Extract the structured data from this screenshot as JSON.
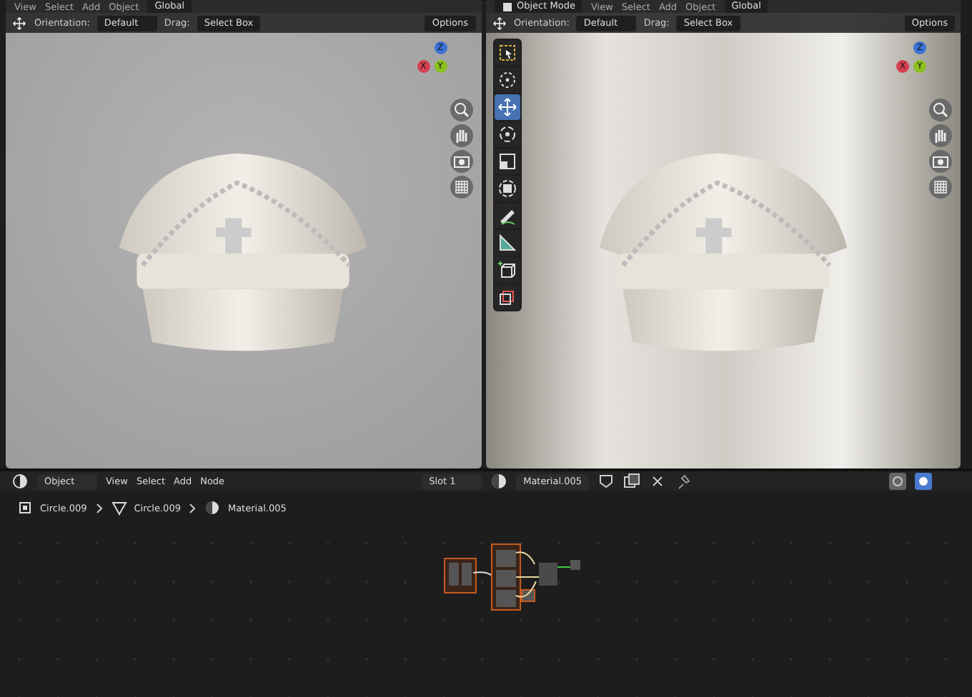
{
  "viewports": [
    {
      "menus": [
        "View",
        "Select",
        "Add",
        "Object"
      ],
      "transform": "Global",
      "orientation_label": "Orientation:",
      "orientation": "Default",
      "drag_label": "Drag:",
      "drag": "Select Box",
      "options": "Options",
      "gizmo": {
        "x": "X",
        "y": "Y",
        "z": "Z"
      }
    },
    {
      "mode": "Object Mode",
      "menus": [
        "View",
        "Select",
        "Add",
        "Object"
      ],
      "transform": "Global",
      "orientation_label": "Orientation:",
      "orientation": "Default",
      "drag_label": "Drag:",
      "drag": "Select Box",
      "options": "Options",
      "gizmo": {
        "x": "X",
        "y": "Y",
        "z": "Z"
      },
      "toolbar": [
        {
          "kind": "select",
          "selected": false
        },
        {
          "kind": "cursor",
          "selected": false
        },
        {
          "kind": "move",
          "selected": true
        },
        {
          "kind": "rotate",
          "selected": false
        },
        {
          "kind": "scale",
          "selected": false
        },
        {
          "kind": "transform",
          "selected": false
        },
        {
          "kind": "annotate",
          "selected": false
        },
        {
          "kind": "measure",
          "selected": false
        },
        {
          "kind": "add-cube",
          "selected": false
        },
        {
          "kind": "shear",
          "selected": false
        }
      ]
    }
  ],
  "node_editor": {
    "object_mode": "Object",
    "menus": [
      "View",
      "Select",
      "Add",
      "Node"
    ],
    "slot": "Slot 1",
    "material": "Material.005",
    "breadcrumbs": [
      {
        "kind": "object",
        "label": "Circle.009"
      },
      {
        "kind": "mesh",
        "label": "Circle.009"
      },
      {
        "kind": "material",
        "label": "Material.005"
      }
    ]
  }
}
